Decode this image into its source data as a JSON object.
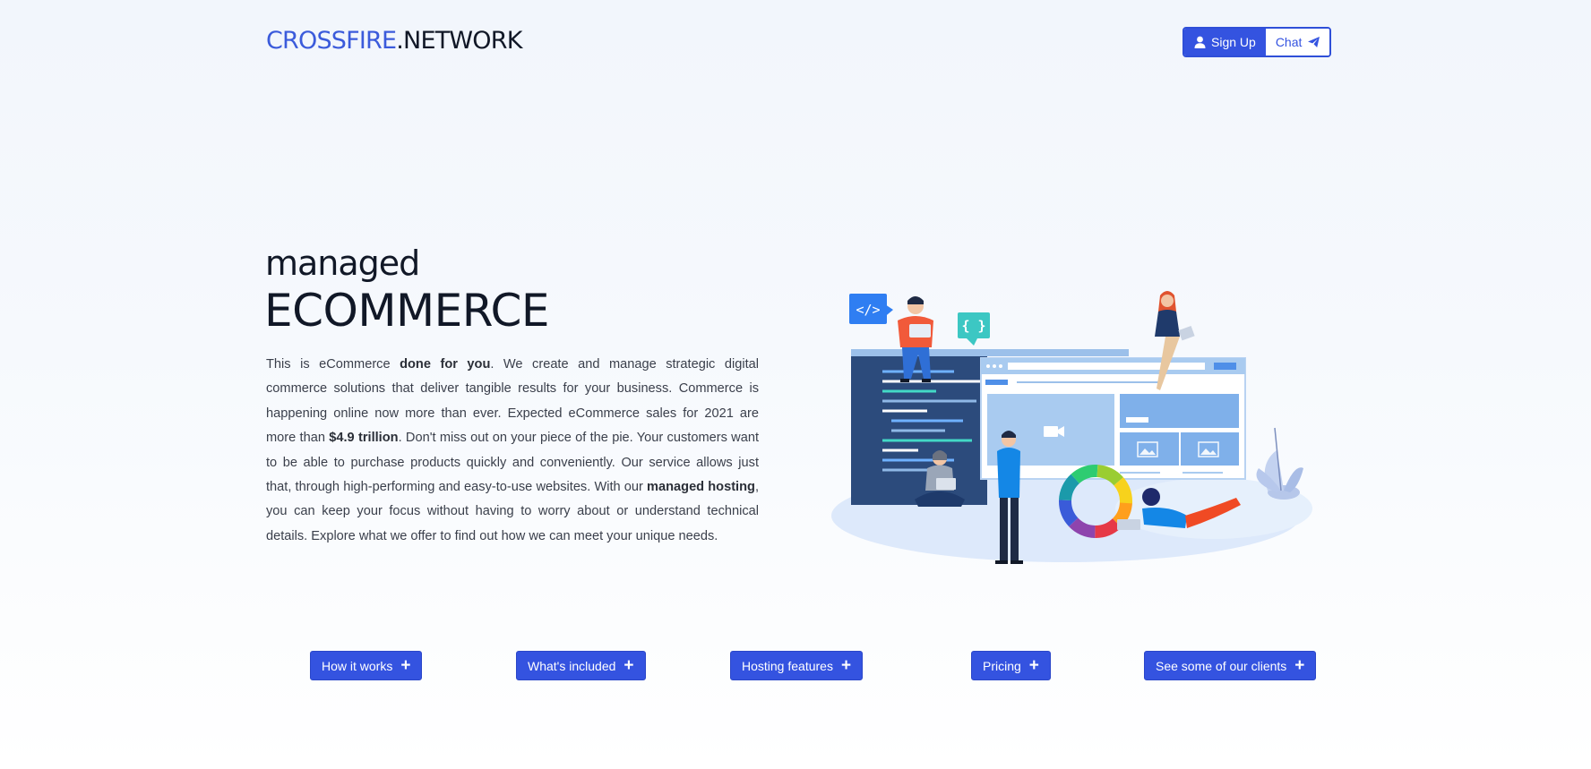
{
  "header": {
    "logo_brand": "CROSSFIRE",
    "logo_tld": ".NETWORK",
    "signup_label": "Sign Up",
    "chat_label": "Chat",
    "signup_icon": "user-icon",
    "chat_icon": "paper-plane-icon"
  },
  "hero": {
    "title_small": "managed",
    "title_big": "ECOMMERCE",
    "intro": [
      {
        "text": "This is eCommerce "
      },
      {
        "text": "done for you",
        "bold": true
      },
      {
        "text": ". We create and manage strategic digital commerce solutions that deliver tangible results for your business. Commerce is happening online now more than ever. Expected eCommerce sales for 2021 are more than "
      },
      {
        "text": "$4.9 trillion",
        "bold": true
      },
      {
        "text": ". Don't miss out on your piece of the pie. Your customers want to be able to purchase products quickly and conveniently. Our service allows just that, through high-performing and easy-to-use websites. With our "
      },
      {
        "text": "managed hosting",
        "bold": true
      },
      {
        "text": ", you can keep your focus without having to worry about or understand technical details. Explore what we offer to find out how we can meet your unique needs."
      }
    ],
    "illustration_labels": {
      "code_tag": "</>",
      "braces": "{ }"
    }
  },
  "sections": [
    {
      "label": "How it works"
    },
    {
      "label": "What's included"
    },
    {
      "label": "Hosting features"
    },
    {
      "label": "Pricing"
    },
    {
      "label": "See some of our clients"
    }
  ],
  "colors": {
    "accent": "#3453e0",
    "logo_brand": "#3b5bdb",
    "text_dark": "#111827",
    "body_text": "#3a3f4b"
  }
}
